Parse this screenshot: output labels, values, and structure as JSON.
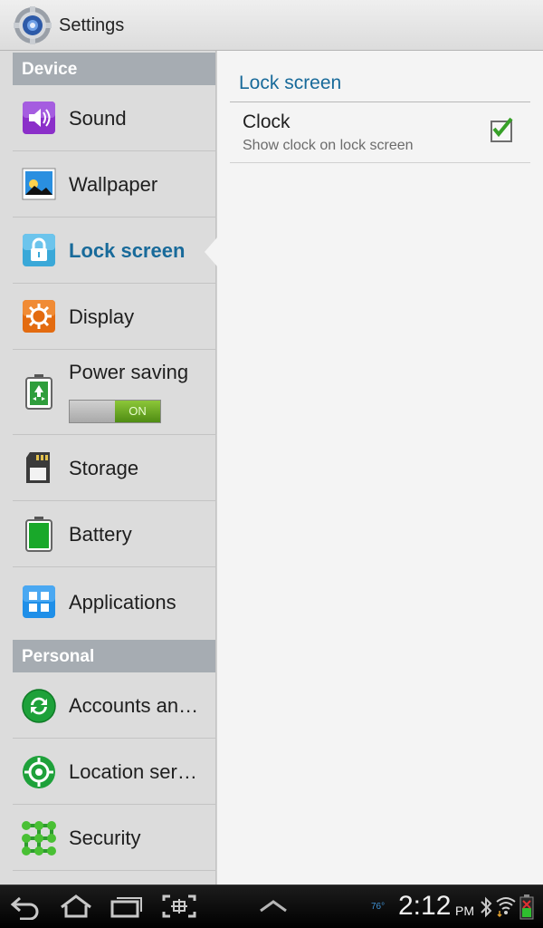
{
  "app": {
    "title": "Settings",
    "icon": "gear-icon"
  },
  "sidebar": {
    "sections": [
      {
        "header": "Device"
      },
      {
        "header": "Personal"
      }
    ],
    "items": [
      {
        "label": "Sound",
        "icon": "speaker-icon"
      },
      {
        "label": "Wallpaper",
        "icon": "wallpaper-icon"
      },
      {
        "label": "Lock screen",
        "icon": "lock-icon",
        "selected": true
      },
      {
        "label": "Display",
        "icon": "display-brightness-icon"
      },
      {
        "label": "Power saving",
        "icon": "recycle-battery-icon",
        "toggle": "ON"
      },
      {
        "label": "Storage",
        "icon": "sd-card-icon"
      },
      {
        "label": "Battery",
        "icon": "battery-icon"
      },
      {
        "label": "Applications",
        "icon": "apps-grid-icon"
      },
      {
        "label": "Accounts an…",
        "icon": "sync-icon"
      },
      {
        "label": "Location ser…",
        "icon": "location-target-icon"
      },
      {
        "label": "Security",
        "icon": "security-pattern-icon"
      }
    ]
  },
  "detail": {
    "title": "Lock screen",
    "prefs": [
      {
        "title": "Clock",
        "summary": "Show clock on lock screen",
        "checked": true
      }
    ]
  },
  "status_bar": {
    "time": "2:12",
    "ampm": "PM",
    "temperature": "76°",
    "icons": [
      "bluetooth-icon",
      "wifi-icon",
      "battery-charging-icon"
    ]
  },
  "nav_bar": {
    "buttons": [
      "back-icon",
      "home-icon",
      "recent-apps-icon",
      "screenshot-icon",
      "expand-up-icon"
    ]
  },
  "colors": {
    "accent": "#186a9a",
    "toggle_on": "#5f9e1e",
    "header": "#a6acb2"
  }
}
